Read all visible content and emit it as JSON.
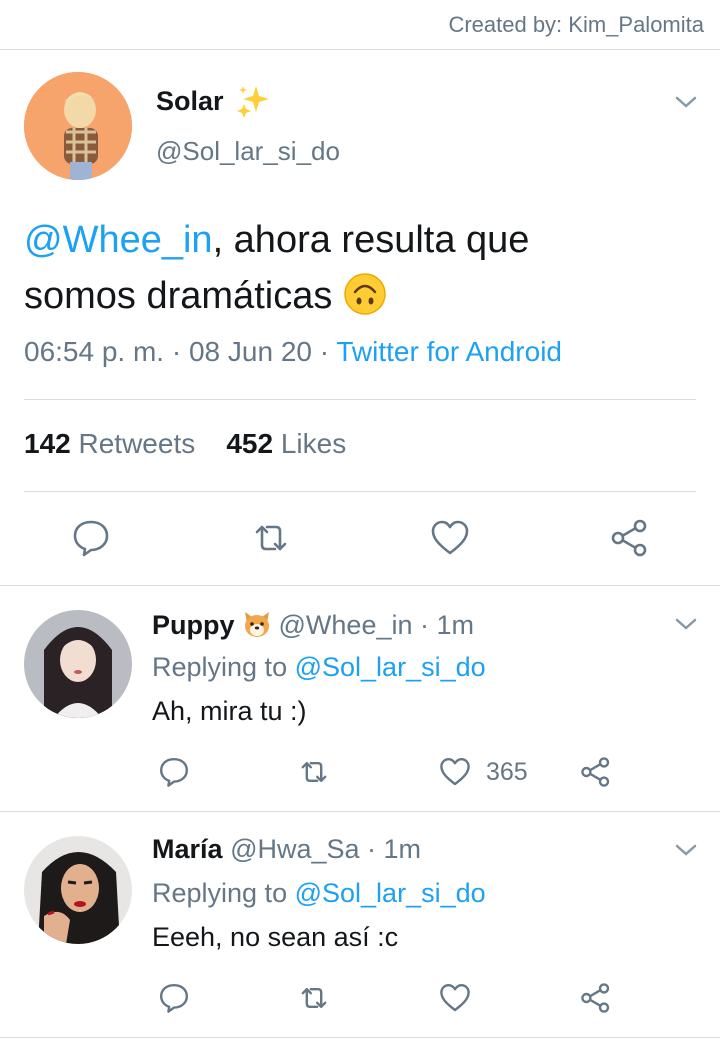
{
  "credit": "Created by: Kim_Palomita",
  "main_tweet": {
    "name": "Solar",
    "handle": "@Sol_lar_si_do",
    "mention": "@Whee_in",
    "text_line1_rest": ", ahora resulta que",
    "text_line2": "somos dramáticas",
    "time": "06:54 p. m. · 08 Jun 20 · ",
    "source": "Twitter for Android",
    "retweets_count": "142",
    "retweets_label": "Retweets",
    "likes_count": "452",
    "likes_label": "Likes"
  },
  "replies": [
    {
      "name": "Puppy",
      "handle": "@Whee_in",
      "time": "· 1m",
      "replying_label": "Replying to",
      "replying_to": "@Sol_lar_si_do",
      "text": "Ah, mira tu :)",
      "likes": "365"
    },
    {
      "name": "María",
      "handle": "@Hwa_Sa",
      "time": "· 1m",
      "replying_label": "Replying to",
      "replying_to": "@Sol_lar_si_do",
      "text": "Eeeh, no sean así :c",
      "likes": ""
    }
  ],
  "colors": {
    "link": "#1da1f2",
    "secondary_text": "#657786",
    "divider": "#d6dde3"
  },
  "icons": [
    "sparkles-icon",
    "chevron-down-icon",
    "reply-icon",
    "retweet-icon",
    "like-icon",
    "share-icon",
    "upside-down-face-icon",
    "dog-face-icon"
  ]
}
